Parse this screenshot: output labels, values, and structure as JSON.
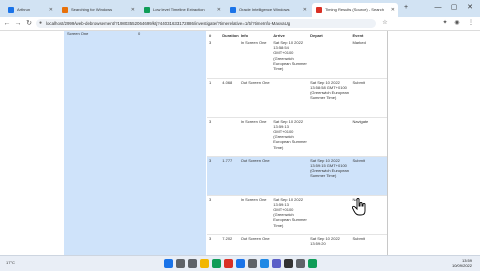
{
  "tabs": [
    {
      "label": "Arthrun",
      "color": "#1a73e8"
    },
    {
      "label": "Searching for Windows",
      "color": "#e8710a"
    },
    {
      "label": "Low level Timeline Extraction",
      "color": "#0f9d58"
    },
    {
      "label": "Oracle Intelligence Windows",
      "color": "#1a73e8"
    },
    {
      "label": "Timing Results (Source) - Search",
      "color": "#d93025",
      "active": true
    }
  ],
  "tab_new": "+",
  "window_controls": {
    "minimize": "—",
    "maximize": "▢",
    "close": "✕"
  },
  "address": {
    "url": "localhost/2999/web-debrowsement/?19803552064699/ktj?44031633172886/investigate/?timerelative=1/5/?timeInfo-MaxvaUg"
  },
  "icons": {
    "back": "back-arrow-icon",
    "forward": "forward-arrow-icon",
    "reload": "reload-icon",
    "lock": "lock-icon",
    "star": "star-icon",
    "extensions": "puzzle-icon",
    "profile": "profile-icon",
    "menu": "kebab-menu-icon"
  },
  "left_panel": {
    "name": "Screen One",
    "value": "0"
  },
  "table": {
    "headers": [
      "#",
      "Duration",
      "Info",
      "Arrive",
      "Depart",
      "Event"
    ],
    "rows": [
      {
        "id": "3",
        "duration": "",
        "info": "In Screen One",
        "arrive": "Sat Sep 10 2022 13:58:54 GMT+0100 (Greenwich European Summer Time)",
        "depart": "",
        "event": "Marked",
        "highlight": false
      },
      {
        "id": "1",
        "duration": "4.068",
        "info": "Out Screen One",
        "arrive": "",
        "depart": "Sat Sep 10 2022 13:58:58 GMT+0100 (Greenwich European Summer Time)",
        "event": "Submit",
        "highlight": false
      },
      {
        "id": "3",
        "duration": "",
        "info": "In Screen One",
        "arrive": "Sat Sep 10 2022 13:59:13 GMT+0100 (Greenwich European Summer Time)",
        "depart": "",
        "event": "Navigate",
        "highlight": false
      },
      {
        "id": "3",
        "duration": "1.777",
        "info": "Out Screen One",
        "arrive": "",
        "depart": "Sat Sep 10 2022 13:59:15 GMT+0100 (Greenwich European Summer Time)",
        "event": "Submit",
        "highlight": true
      },
      {
        "id": "3",
        "duration": "",
        "info": "In Screen One",
        "arrive": "Sat Sep 10 2022 13:59:13 GMT+0100 (Greenwich European Summer Time)",
        "depart": "",
        "event": "Nav",
        "highlight": false
      },
      {
        "id": "3",
        "duration": "7.202",
        "info": "Out Screen One",
        "arrive": "",
        "depart": "Sat Sep 10 2022 13:59:20",
        "event": "Submit",
        "highlight": false
      }
    ]
  },
  "taskbar": {
    "apps": [
      {
        "icon": "windows-start-icon",
        "color": "#1a73e8"
      },
      {
        "icon": "search-icon",
        "color": "#5f6368"
      },
      {
        "icon": "task-view-icon",
        "color": "#5f6368"
      },
      {
        "icon": "file-explorer-icon",
        "color": "#f2b600"
      },
      {
        "icon": "edge-icon",
        "color": "#0f9d58"
      },
      {
        "icon": "chrome-icon",
        "color": "#d93025"
      },
      {
        "icon": "mail-icon",
        "color": "#1a73e8"
      },
      {
        "icon": "store-icon",
        "color": "#5f6368"
      },
      {
        "icon": "vs-code-icon",
        "color": "#1e88e5"
      },
      {
        "icon": "teams-icon",
        "color": "#5b5fc7"
      },
      {
        "icon": "terminal-icon",
        "color": "#333333"
      },
      {
        "icon": "settings-icon",
        "color": "#5f6368"
      },
      {
        "icon": "photos-icon",
        "color": "#0f9d58"
      }
    ],
    "weather": "17°C",
    "time": "13:59",
    "date": "10/09/2022"
  }
}
